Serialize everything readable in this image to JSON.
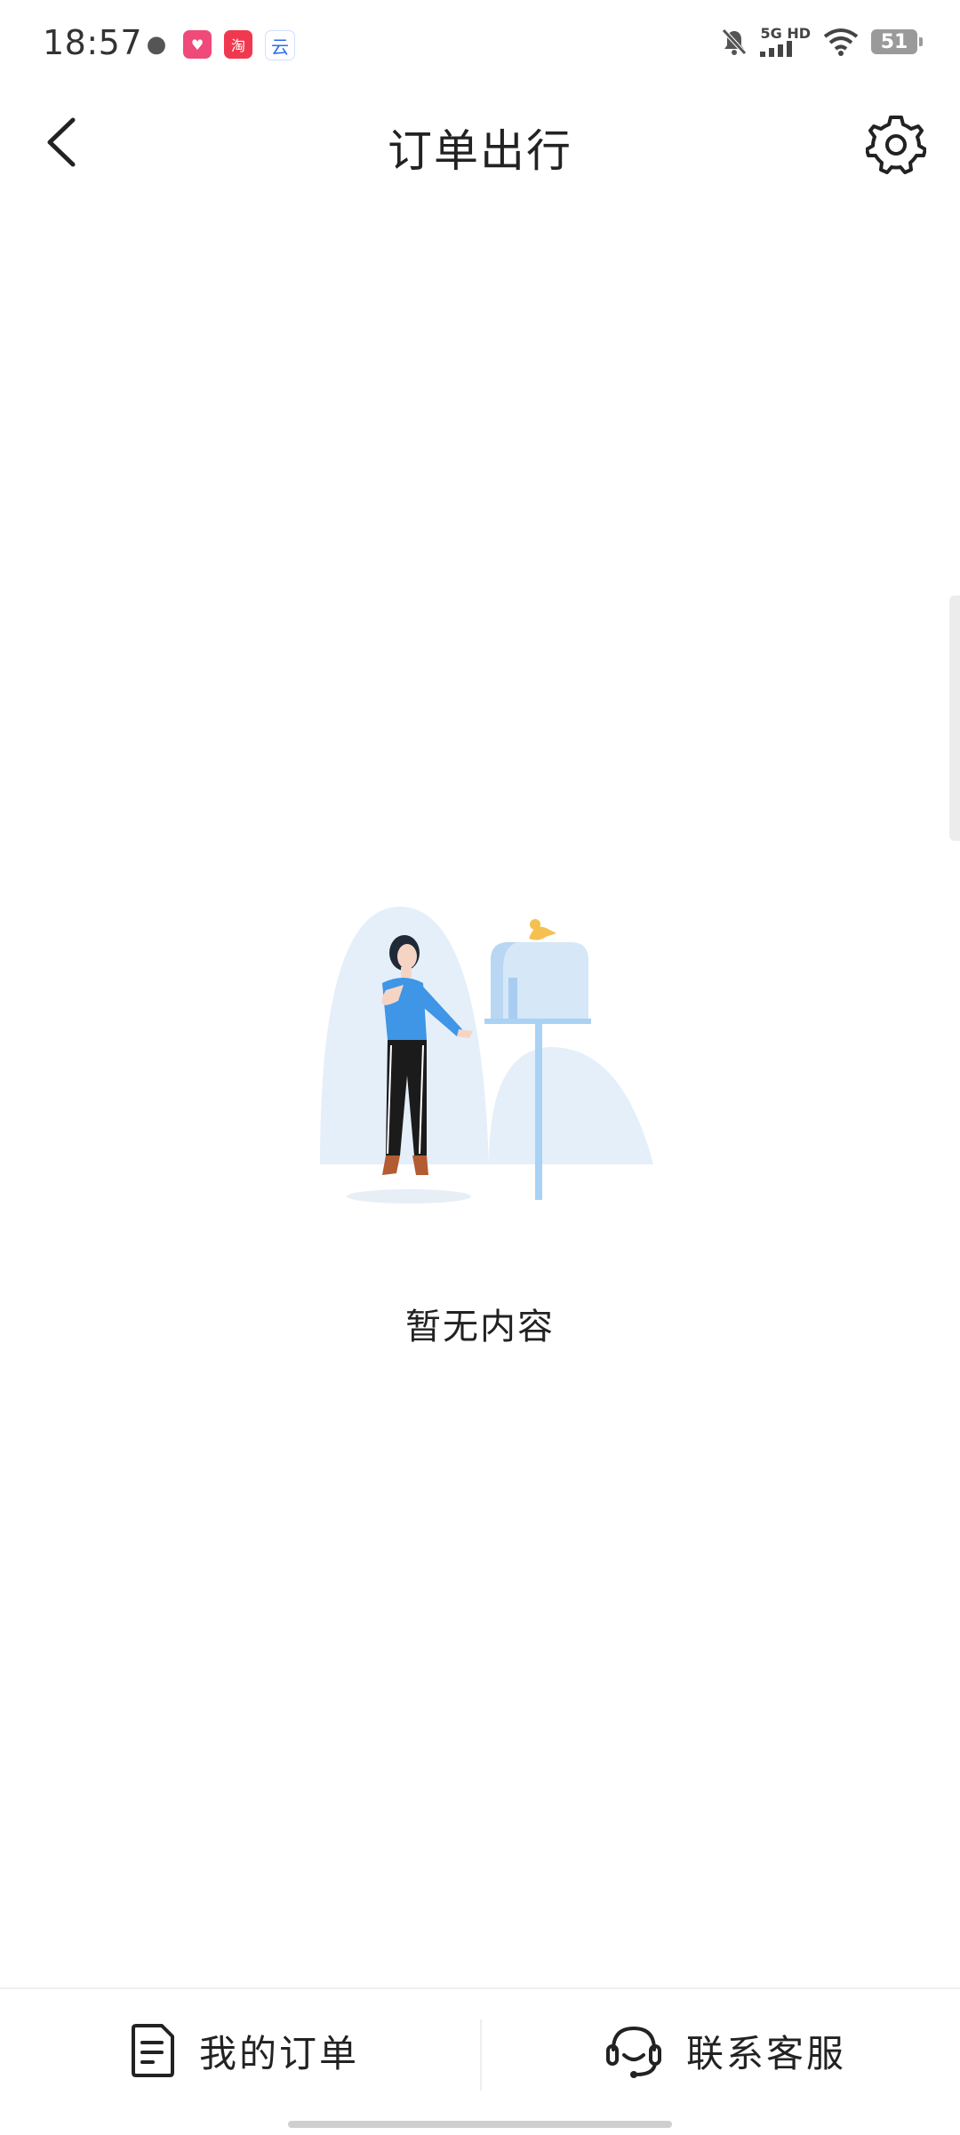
{
  "status_bar": {
    "time": "18:57",
    "network": "5G HD",
    "battery": "51",
    "app_icons": [
      "wechat-icon",
      "pinduoduo-icon",
      "taobao-icon",
      "cloud-app-icon"
    ]
  },
  "header": {
    "title": "订单出行",
    "back_icon": "chevron-left-icon",
    "settings_icon": "gear-icon"
  },
  "empty_state": {
    "message": "暂无内容",
    "illustration": "woman-with-mailbox"
  },
  "bottom_bar": {
    "my_orders": {
      "label": "我的订单",
      "icon": "document-icon"
    },
    "customer_service": {
      "label": "联系客服",
      "icon": "headset-icon"
    }
  },
  "colors": {
    "illustration_bg": "#e5eff9",
    "mailbox": "#cfe3f5",
    "accent_blue": "#3f95e6",
    "bird": "#f5c04f"
  }
}
